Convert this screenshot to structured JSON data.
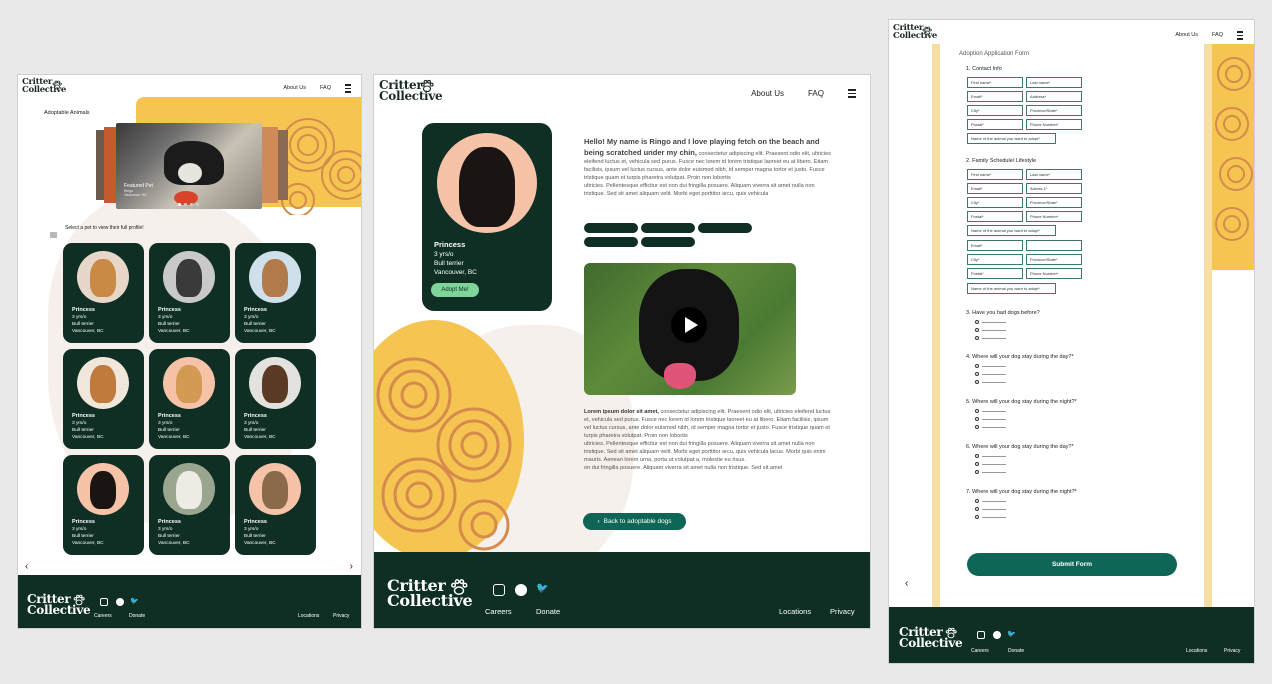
{
  "brand": {
    "line1": "Critter",
    "line2": "Collective"
  },
  "nav": {
    "about": "About Us",
    "faq": "FAQ"
  },
  "footer": {
    "careers": "Careers",
    "donate": "Donate",
    "locations": "Locations",
    "privacy": "Privacy"
  },
  "colors": {
    "dark_green": "#0f2f24",
    "teal": "#0f6656",
    "mint": "#7fd49a",
    "yellow": "#f6c451",
    "orange": "#d48b4c",
    "peach": "#f6c3a8"
  },
  "listing": {
    "title": "Adoptable Animals",
    "featured": {
      "label": "Featured Pet",
      "sub1": "Ringo",
      "sub2": "Vancouver, BC"
    },
    "instruction": "Select a pet to view their full profile!",
    "cards": [
      {
        "name": "Princess",
        "age": "3 yrs/o",
        "breed": "Bull terrier",
        "city": "Vancouver, BC",
        "photo": "golden"
      },
      {
        "name": "Princess",
        "age": "3 yrs/o",
        "breed": "Bull terrier",
        "city": "Vancouver, BC",
        "photo": "husky"
      },
      {
        "name": "Princess",
        "age": "3 yrs/o",
        "breed": "Bull terrier",
        "city": "Vancouver, BC",
        "photo": "aussie"
      },
      {
        "name": "Princess",
        "age": "3 yrs/o",
        "breed": "Bull terrier",
        "city": "Vancouver, BC",
        "photo": "doodle"
      },
      {
        "name": "Princess",
        "age": "3 yrs/o",
        "breed": "Bull terrier",
        "city": "Vancouver, BC",
        "photo": "retriever"
      },
      {
        "name": "Princess",
        "age": "3 yrs/o",
        "breed": "Bull terrier",
        "city": "Vancouver, BC",
        "photo": "beagle"
      },
      {
        "name": "Princess",
        "age": "3 yrs/o",
        "breed": "Bull terrier",
        "city": "Vancouver, BC",
        "photo": "lab"
      },
      {
        "name": "Princess",
        "age": "3 yrs/o",
        "breed": "Bull terrier",
        "city": "Vancouver, BC",
        "photo": "samoyed"
      },
      {
        "name": "Princess",
        "age": "3 yrs/o",
        "breed": "Bull terrier",
        "city": "Vancouver, BC",
        "photo": "terrier"
      }
    ]
  },
  "profile": {
    "name": "Princess",
    "age": "3 yrs/o",
    "breed": "Bull terrier",
    "city": "Vancouver, BC",
    "adopt_label": "Adopt Me!",
    "intro_bold": "Hello! My name is Ringo and I love playing fetch on the beach and being scratched under my chin,",
    "intro_rest": " consectetur adipiscing elit. Praesent odio elit, ultricies eleifend luctus et, vehicula sed purus. Fusce nec lorem id lorem tristique laoreet eu at libero. Etiam facilisis, ipsum vel luctus cursus, ante dolor euismod nibh, id semper magna tortor et justo. Fusce tristique quam et turpis pharetra volutpat. Proin non lobortis",
    "intro_rest2": "ultricies. Pellentesque efficitur est non dui fringilla posuere. Aliquam viverra sit amet nulla non tristique. Sed sit amet aliquam velit. Morbi eget porttitor arcu, quis vehicula",
    "body_bold": "Lorem ipsum dolor sit amet,",
    "body_rest": " consectetur adipiscing elit. Praesent odio elit, ultricies eleifend luctus et, vehicula sed purus. Fusce nec lorem id lorem tristique laoreet eu at libero. Etiam facilisis, ipsum vel luctus cursus, ante dolor euismod nibh, id semper magna tortor et justo. Fusce tristique quam et turpis pharetra volutpat. Proin non lobortis",
    "body_rest2": "ultricies. Pellentesque efficitur est non dui fringilla posuere. Aliquam viverra sit amet nulla non tristique. Sed sit amet aliquam velit. Morbi eget porttitor arcu, quis vehicula lacus. Morbi quis enim mauris. Aenean lorem urna, porta ut volutpat a, molestie eu risus.",
    "body_rest3": "on dui fringilla posuere. Aliquam viverra sit amet nulla non tristique. Sed sit amet",
    "back_label": "Back to adoptable dogs"
  },
  "form": {
    "title": "Adoption Application Form",
    "s1": "1. Contact Info",
    "s2": "2. Family Schedule/ Lifestyle",
    "f_first": "First name*",
    "f_last": "Last name*",
    "f_email": "Email*",
    "f_address": "Address*",
    "f_address2": "Adress 1*",
    "f_city": "City*",
    "f_province": "Province/State*",
    "f_postal": "Postal*",
    "f_phone": "Phone Number*",
    "f_animal": "Name of the animal you want to adopt*",
    "q3": "3. Have you had dogs before?",
    "q4": "4. Where will your dog stay during the day?*",
    "q5": "5. Where will your dog stay during the night?*",
    "q6": "6. Where will your dog stay during the day?*",
    "q7": "7. Where will your dog stay during the night?*",
    "submit": "Submit Form"
  }
}
